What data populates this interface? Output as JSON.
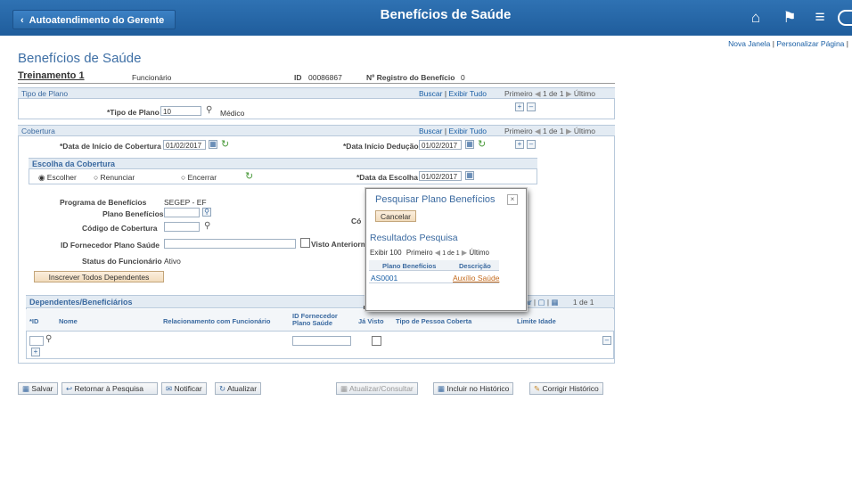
{
  "header": {
    "back_label": "Autoatendimento do Gerente",
    "title": "Benefícios de Saúde",
    "icons": [
      "home-icon",
      "flag-icon",
      "menu-icon",
      "navbar-icon"
    ]
  },
  "top_links": {
    "new_window": "Nova Janela",
    "separator": "|",
    "personalize": "Personalizar Página",
    "sep2": "|"
  },
  "page_title": "Benefícios de Saúde",
  "employee": {
    "name": "Treinamento 1",
    "type": "Funcionário",
    "id_label": "ID",
    "id_value": "00086867",
    "reg_label": "Nº Registro do Benefício",
    "reg_value": "0"
  },
  "plan_type": {
    "section": "Tipo de Plano",
    "find": "Buscar",
    "sep": "|",
    "view_all": "Exibir Tudo",
    "first": "Primeiro",
    "range": "1 de 1",
    "last": "Último",
    "field_label": "*Tipo de Plano",
    "field_value": "10",
    "desc": "Médico"
  },
  "coverage": {
    "section": "Cobertura",
    "find": "Buscar",
    "sep": "|",
    "view_all": "Exibir Tudo",
    "first": "Primeiro",
    "range": "1 de 1",
    "last": "Último",
    "start_label": "*Data de Início de Cobertura",
    "start_value": "01/02/2017",
    "deduct_label": "*Data Início Dedução",
    "deduct_value": "01/02/2017"
  },
  "choice": {
    "section": "Escolha da Cobertura",
    "options": [
      "Escolher",
      "Renunciar",
      "Encerrar"
    ],
    "date_label": "*Data da Escolha",
    "date_value": "01/02/2017"
  },
  "program": {
    "program_label": "Programa de Benefícios",
    "program_value": "SEGEP - EF",
    "plan_label": "Plano Benefícios",
    "coverage_code_label": "Código de Cobertura",
    "cov_trunc_label": "Có",
    "provider_label": "ID Fornecedor Plano Saúde",
    "seen_label": "Visto Anteriorm",
    "status_label": "Status do Funcionário",
    "status_value": "Ativo",
    "enroll_button": "Inscrever Todos Dependentes"
  },
  "dependents": {
    "section": "Dependentes/Beneficiários",
    "customize": "..zar",
    "sep": "|",
    "range": "1 de 1",
    "columns": [
      "*ID",
      "Nome",
      "Relacionamento com Funcionário",
      "ID Fornecedor Plano Saúde",
      "Já Visto",
      "Tipo de Pessoa Coberta",
      "Limite Idade"
    ]
  },
  "toolbar": {
    "save": "Salvar",
    "return": "Retornar à Pesquisa",
    "notify": "Notificar",
    "refresh": "Atualizar",
    "update_display": "Atualizar/Consultar",
    "include_history": "Incluir no Histórico",
    "correct_history": "Corrigir Histórico"
  },
  "modal": {
    "title": "Pesquisar Plano Benefícios",
    "cancel": "Cancelar",
    "results_title": "Resultados Pesquisa",
    "show": "Exibir 100",
    "first": "Primeiro",
    "range": "1 de 1",
    "last": "Último",
    "columns": [
      "Plano Benefícios",
      "Descrição"
    ],
    "rows": [
      {
        "plan": "AS0001",
        "desc": "Auxílio Saúde"
      }
    ]
  }
}
